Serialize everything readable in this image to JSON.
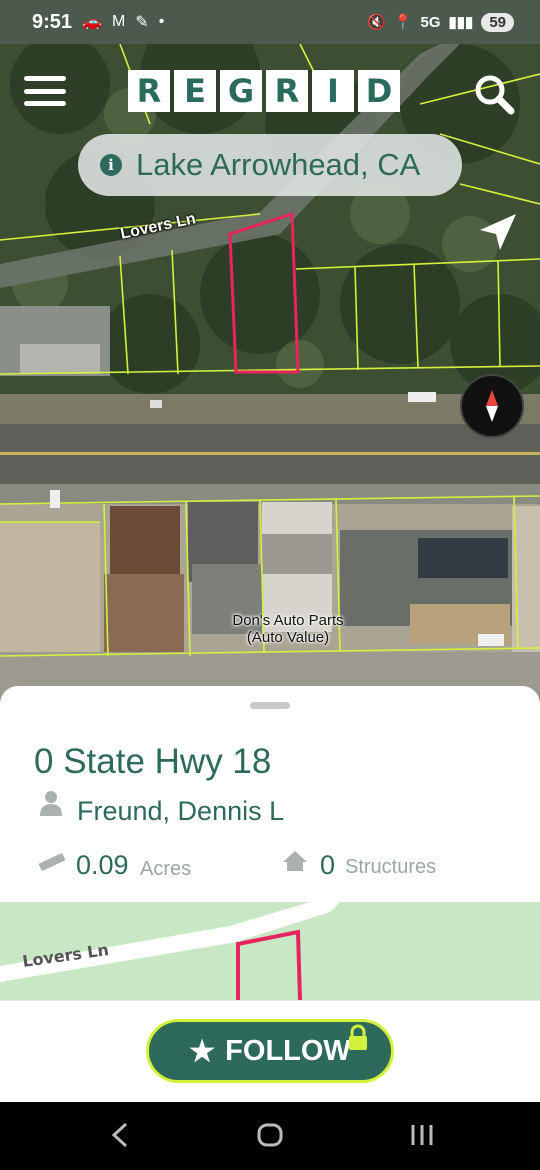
{
  "status_bar": {
    "time": "9:51",
    "network": "5G",
    "battery": "59"
  },
  "header": {
    "logo_letters": [
      "R",
      "E",
      "G",
      "R",
      "I",
      "D"
    ],
    "location": "Lake Arrowhead, CA"
  },
  "map": {
    "street_label": "Lovers Ln",
    "poi_line1": "Don's Auto Parts",
    "poi_line2": "(Auto Value)",
    "parcel_line_color": "#d4f03c",
    "selected_parcel_color": "#e8245f"
  },
  "parcel": {
    "address": "0 State Hwy 18",
    "owner": "Freund, Dennis L",
    "acres_value": "0.09",
    "acres_label": "Acres",
    "structures_value": "0",
    "structures_label": "Structures"
  },
  "mini_map": {
    "street_label": "Lovers Ln"
  },
  "follow_button": {
    "label": "FOLLOW"
  },
  "colors": {
    "brand": "#2e6a5c",
    "accent": "#d3f13a"
  }
}
